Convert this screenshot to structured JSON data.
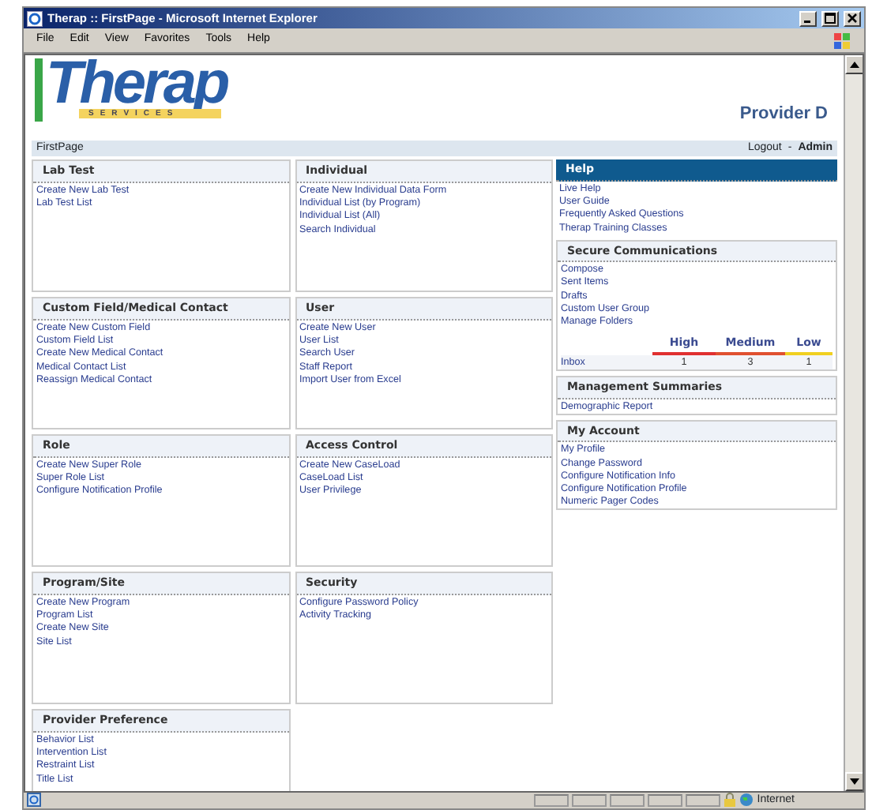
{
  "window": {
    "title": "Therap :: FirstPage - Microsoft Internet Explorer"
  },
  "menu": [
    "File",
    "Edit",
    "View",
    "Favorites",
    "Tools",
    "Help"
  ],
  "header": {
    "logo": "Therap",
    "tagline": "SERVICES",
    "provider": "Provider D"
  },
  "breadcrumb": {
    "page": "FirstPage",
    "logout": "Logout",
    "separator": "-",
    "role": "Admin"
  },
  "sections": [
    {
      "title": "Lab Test",
      "links": [
        "Create New Lab Test",
        "Lab Test List"
      ]
    },
    {
      "title": "Individual",
      "links": [
        "Create New Individual Data Form",
        "Individual List (by Program)",
        "Individual List (All)",
        "Search Individual"
      ]
    },
    {
      "title": "Custom Field/Medical Contact",
      "links": [
        "Create New Custom Field",
        "Custom Field List",
        "Create New Medical Contact",
        "Medical Contact List",
        "Reassign Medical Contact"
      ]
    },
    {
      "title": "User",
      "links": [
        "Create New User",
        "User List",
        "Search User",
        "Staff Report",
        "Import User from Excel"
      ]
    },
    {
      "title": "Role",
      "links": [
        "Create New Super Role",
        "Super Role List",
        "Configure Notification Profile"
      ]
    },
    {
      "title": "Access Control",
      "links": [
        "Create New CaseLoad",
        "CaseLoad List",
        "User Privilege"
      ]
    },
    {
      "title": "Program/Site",
      "links": [
        "Create New Program",
        "Program List",
        "Create New Site",
        "Site List"
      ]
    },
    {
      "title": "Security",
      "links": [
        "Configure Password Policy",
        "Activity Tracking"
      ]
    },
    {
      "title": "Provider Preference",
      "links": [
        "Behavior List",
        "Intervention List",
        "Restraint List",
        "Title List"
      ]
    }
  ],
  "help": {
    "title": "Help",
    "links": [
      "Live Help",
      "User Guide",
      "Frequently Asked Questions",
      "Therap Training Classes"
    ]
  },
  "secure_communications": {
    "title": "Secure Communications",
    "links": [
      "Compose",
      "Sent Items",
      "Drafts",
      "Custom User Group",
      "Manage Folders"
    ],
    "priorities": [
      {
        "label": "High",
        "color": "#e03030"
      },
      {
        "label": "Medium",
        "color": "#e05030"
      },
      {
        "label": "Low",
        "color": "#f0d020"
      }
    ],
    "row": {
      "label": "Inbox",
      "counts": [
        "1",
        "3",
        "1"
      ]
    }
  },
  "side_sections": [
    {
      "title": "Management Summaries",
      "links": [
        "Demographic Report"
      ]
    },
    {
      "title": "My Account",
      "links": [
        "My Profile",
        "Change Password",
        "Configure Notification Info",
        "Configure Notification Profile",
        "Numeric Pager Codes"
      ]
    }
  ],
  "status_bar": {
    "zone": "Internet"
  }
}
